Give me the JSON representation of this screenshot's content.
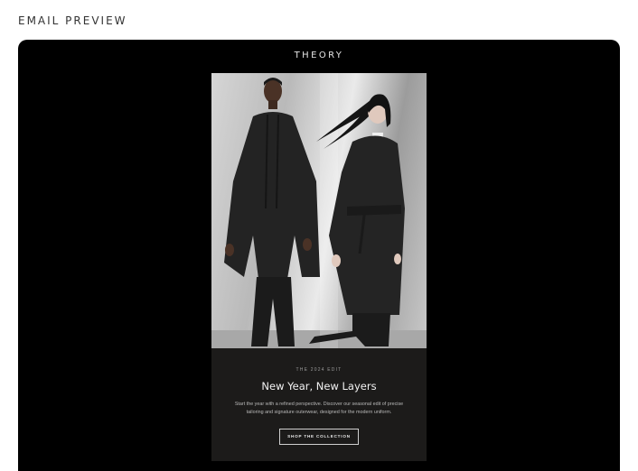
{
  "page": {
    "label": "EMAIL PREVIEW"
  },
  "email": {
    "brand": "THEORY",
    "hero_image": "two models in long dark wool coats against brushed steel backdrop",
    "eyebrow": "THE 2024 EDIT",
    "headline": "New Year, New Layers",
    "body": "Start the year with a refined perspective. Discover our seasonal edit of precise tailoring and signature outerwear, designed for the modern uniform.",
    "cta_label": "SHOP THE COLLECTION"
  },
  "colors": {
    "page_background": "#ffffff",
    "frame_background": "#000000",
    "card_background": "#1c1b1a",
    "text_light": "#f2f2f2"
  }
}
